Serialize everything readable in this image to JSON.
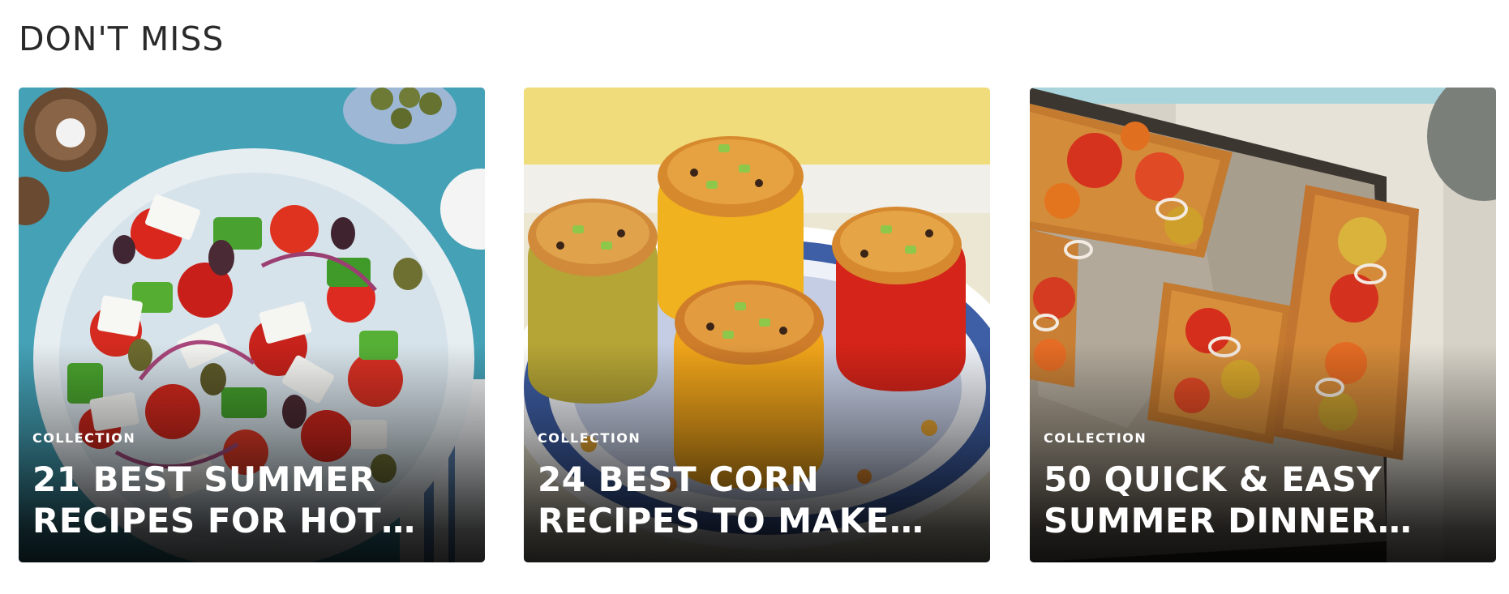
{
  "section": {
    "title": "DON'T MISS"
  },
  "cards": [
    {
      "tag": "COLLECTION",
      "title": "21 BEST SUMMER RECIPES FOR HOT…",
      "image": "greek-salad-photo"
    },
    {
      "tag": "COLLECTION",
      "title": "24 BEST CORN RECIPES TO MAKE…",
      "image": "stuffed-peppers-photo"
    },
    {
      "tag": "COLLECTION",
      "title": "50 QUICK & EASY SUMMER DINNER…",
      "image": "sheet-pan-tomato-tart-photo"
    }
  ]
}
